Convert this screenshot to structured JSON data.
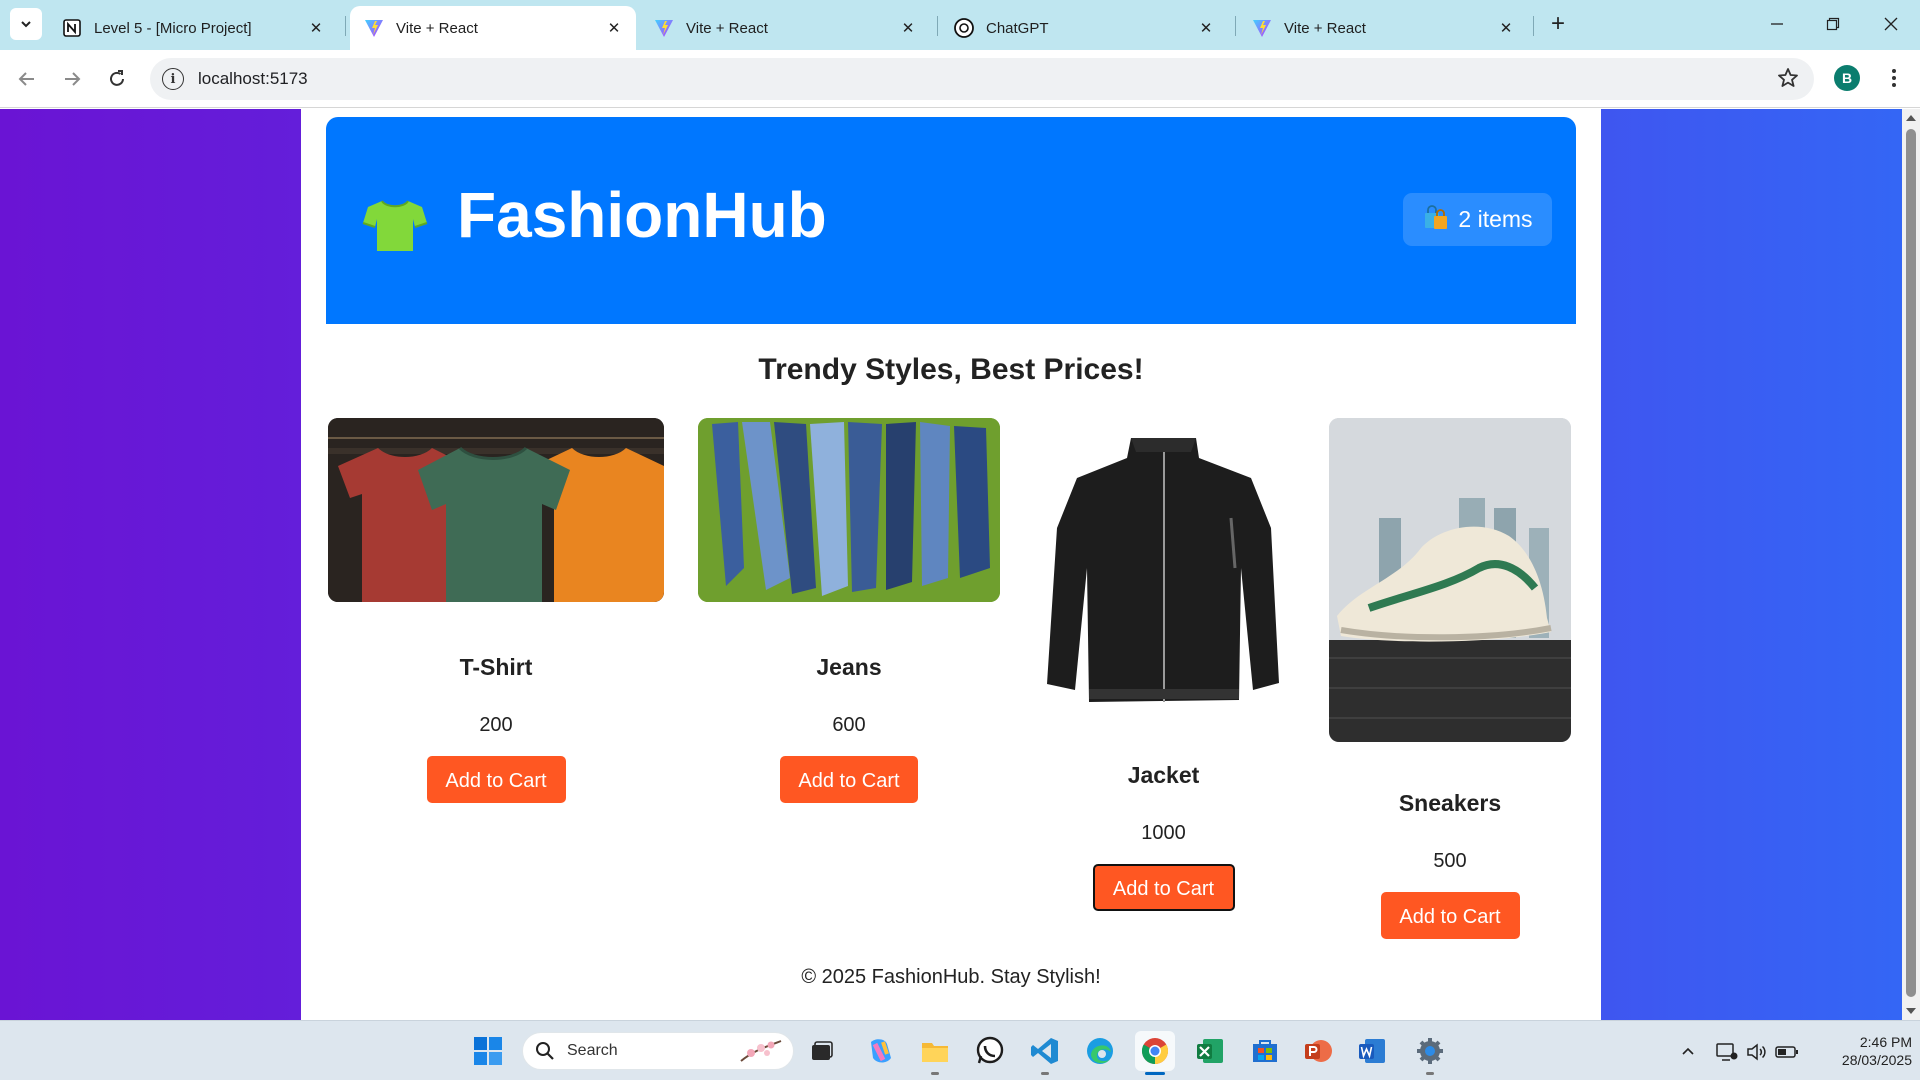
{
  "browser": {
    "tabs": [
      {
        "title": "Level 5 - [Micro Project]",
        "icon": "notion-icon",
        "active": false
      },
      {
        "title": "Vite + React",
        "icon": "vite-icon",
        "active": true
      },
      {
        "title": "Vite + React",
        "icon": "vite-icon",
        "active": false
      },
      {
        "title": "ChatGPT",
        "icon": "chatgpt-icon",
        "active": false
      },
      {
        "title": "Vite + React",
        "icon": "vite-icon",
        "active": false
      }
    ],
    "url": "localhost:5173",
    "profile_initial": "B"
  },
  "page": {
    "brand": "FashionHub",
    "cart_label": "2 items",
    "tagline": "Trendy Styles, Best Prices!",
    "products": [
      {
        "name": "T-Shirt",
        "price": "200",
        "button": "Add to Cart"
      },
      {
        "name": "Jeans",
        "price": "600",
        "button": "Add to Cart"
      },
      {
        "name": "Jacket",
        "price": "1000",
        "button": "Add to Cart"
      },
      {
        "name": "Sneakers",
        "price": "500",
        "button": "Add to Cart"
      }
    ],
    "footer": "© 2025 FashionHub. Stay Stylish!"
  },
  "taskbar": {
    "search_label": "Search",
    "time": "2:46 PM",
    "date": "28/03/2025"
  },
  "colors": {
    "header_blue": "#0077ff",
    "cart_badge": "#2a8dff",
    "button_orange": "#ff5722",
    "bg_gradient_start": "#6a14d4",
    "bg_gradient_end": "#3466f5"
  }
}
